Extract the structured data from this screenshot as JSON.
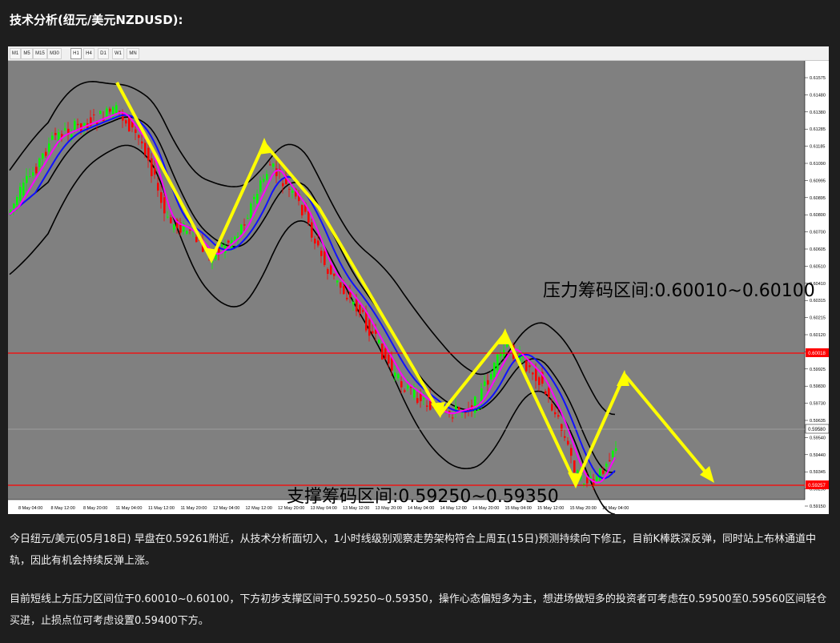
{
  "heading": "技术分析(纽元/美元NZDUSD):",
  "toolbar": {
    "timeframes": [
      "M1",
      "M5",
      "M15",
      "M30",
      "H1",
      "H4",
      "D1",
      "W1",
      "MN"
    ],
    "active": "H1"
  },
  "chart": {
    "annotation_resistance": "压力筹码区间:0.60010~0.60100",
    "annotation_support": "支撑筹码区间:0.59250~0.59350",
    "price_labels": [
      "0.61575",
      "0.61480",
      "0.61380",
      "0.61285",
      "0.61185",
      "0.61090",
      "0.60995",
      "0.60895",
      "0.60800",
      "0.60700",
      "0.60605",
      "0.60510",
      "0.60410",
      "0.60315",
      "0.60215",
      "0.60120",
      "0.60025",
      "0.59925",
      "0.59830",
      "0.59730",
      "0.59635",
      "0.59540",
      "0.59440",
      "0.59345",
      "0.59250",
      "0.59150"
    ],
    "current_price_label": "0.59580",
    "resistance_line_label": "0.60018",
    "support_line_label": "0.59257",
    "time_labels": [
      "8 May 04:00",
      "8 May 12:00",
      "8 May 20:00",
      "11 May 04:00",
      "11 May 12:00",
      "11 May 20:00",
      "12 May 04:00",
      "12 May 12:00",
      "12 May 20:00",
      "13 May 04:00",
      "13 May 12:00",
      "13 May 20:00",
      "14 May 04:00",
      "14 May 12:00",
      "14 May 20:00",
      "15 May 04:00",
      "15 May 12:00",
      "15 May 20:00",
      "18 May 04:00"
    ],
    "colors": {
      "background": "#808080",
      "bull_candle": "#00ff00",
      "bear_candle": "#ff0000",
      "moving_average_fast": "#ff00ff",
      "moving_average_slow": "#0000ff",
      "bollinger": "#000000",
      "arrows": "#ffff00",
      "level_lines": "#ff0000"
    }
  },
  "paragraphs": [
    "今日纽元/美元(05月18日) 早盘在0.59261附近，从技术分析面切入，1小时线级别观察走势架构符合上周五(15日)预测持续向下修正，目前K棒跌深反弹，同时站上布林通道中轨，因此有机会持续反弹上涨。",
    "目前短线上方压力区间位于0.60010~0.60100，下方初步支撑区间于0.59250~0.59350，操作心态偏短多为主，想进场做短多的投资者可考虑在0.59500至0.59560区间轻仓买进，止损点位可考虑设置0.59400下方。"
  ]
}
